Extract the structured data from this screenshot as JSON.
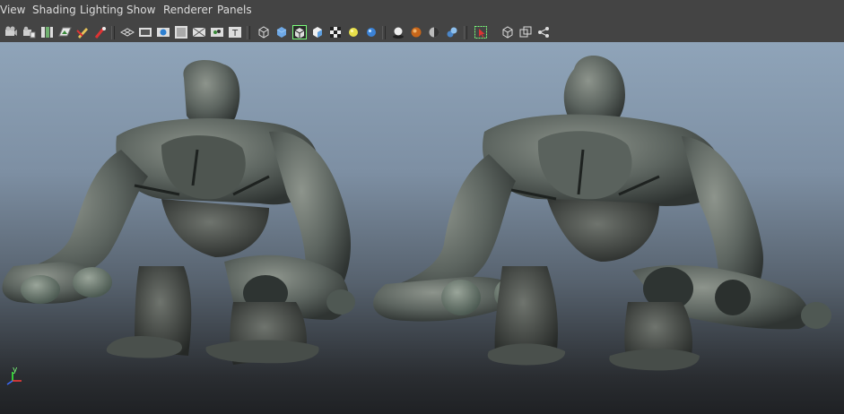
{
  "menu": [
    {
      "label": "View",
      "name": "menu-view"
    },
    {
      "label": "Shading",
      "name": "menu-shading"
    },
    {
      "label": "Lighting",
      "name": "menu-lighting"
    },
    {
      "label": "Show",
      "name": "menu-show"
    },
    {
      "label": "Renderer",
      "name": "menu-renderer"
    },
    {
      "label": "Panels",
      "name": "menu-panels"
    }
  ],
  "toolbar_icons": [
    "select-camera-icon",
    "camera-attributes-icon",
    "bookmarks-icon",
    "image-plane-icon",
    "grease-pencil-icon",
    "2d-pan-zoom-icon",
    "grid-icon",
    "film-gate-icon",
    "resolution-gate-icon",
    "gate-mask-icon",
    "field-chart-icon",
    "safe-action-icon",
    "safe-title-icon",
    "wireframe-icon",
    "smooth-shade-icon",
    "wireframe-on-shaded-icon",
    "flat-shade-icon",
    "textured-icon",
    "default-light-icon",
    "all-lights-icon",
    "shadows-icon",
    "ambient-occlusion-icon",
    "anti-aliasing-icon",
    "depth-of-field-icon",
    "motion-blur-icon",
    "isolate-select-icon",
    "xray-icon",
    "xray-joints-icon",
    "xray-active-icon"
  ],
  "axis": {
    "y_label": "y",
    "x_color": "#ff3b3b",
    "y_color": "#39ff39",
    "z_color": "#3b6bff"
  },
  "colors": {
    "menubar_bg": "#444444",
    "viewport_top": "#8fa4b9",
    "viewport_bottom": "#1f2124"
  }
}
